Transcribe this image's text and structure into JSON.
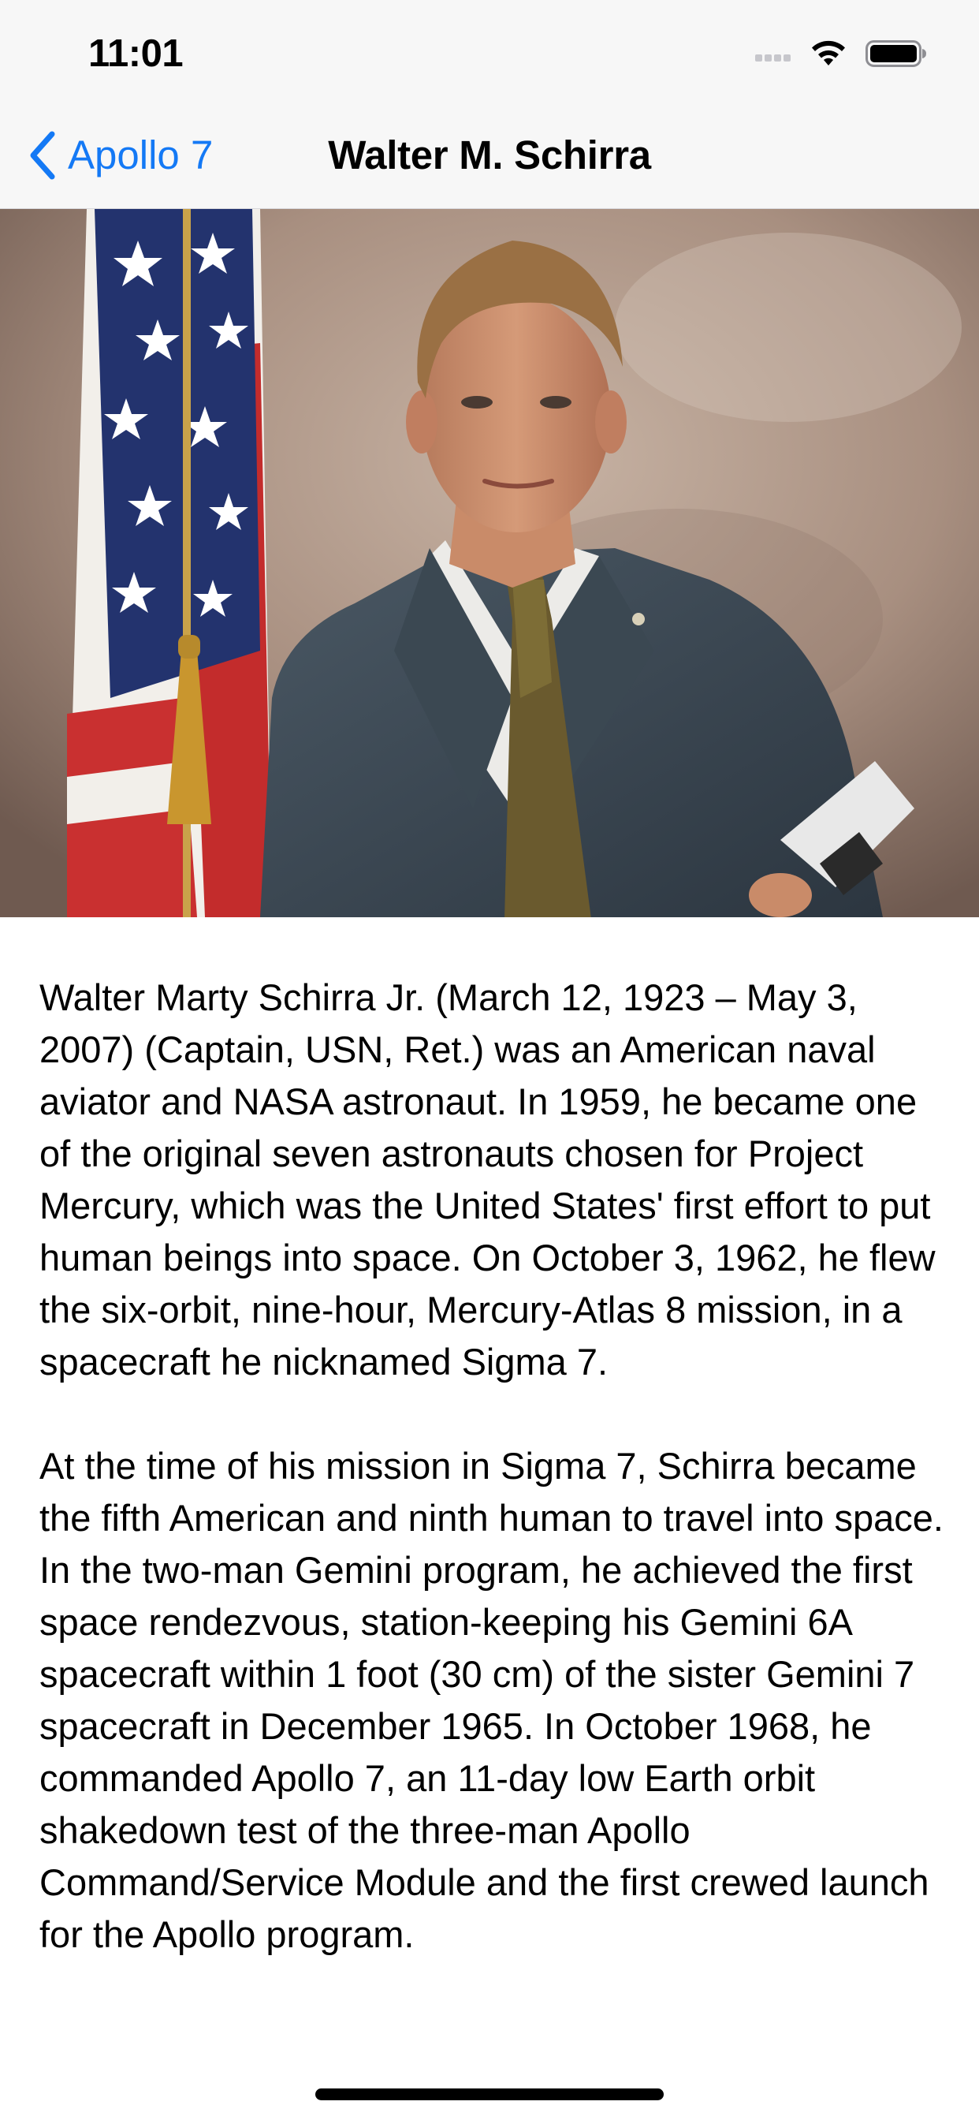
{
  "status_bar": {
    "time": "11:01"
  },
  "nav": {
    "back_label": "Apollo 7",
    "title": "Walter M. Schirra",
    "accent_color": "#1479f5"
  },
  "portrait": {
    "icon": "astronaut-portrait-photo"
  },
  "bio": {
    "paragraphs": [
      "Walter Marty Schirra Jr. (March 12, 1923 – May 3, 2007) (Captain, USN, Ret.) was an American naval aviator and NASA astronaut. In 1959, he became one of the original seven astronauts chosen for Project Mercury, which was the United States' first effort to put human beings into space. On October 3, 1962, he flew the six-orbit, nine-hour, Mercury-Atlas 8 mission, in a spacecraft he nicknamed Sigma 7.",
      "At the time of his mission in Sigma 7, Schirra became the fifth American and ninth human to travel into space. In the two-man Gemini program, he achieved the first space rendezvous, station-keeping his Gemini 6A spacecraft within 1 foot (30 cm) of the sister Gemini 7 spacecraft in December 1965. In October 1968, he commanded Apollo 7, an 11-day low Earth orbit shakedown test of the three-man Apollo Command/Service Module and the first crewed launch for the Apollo program."
    ]
  }
}
